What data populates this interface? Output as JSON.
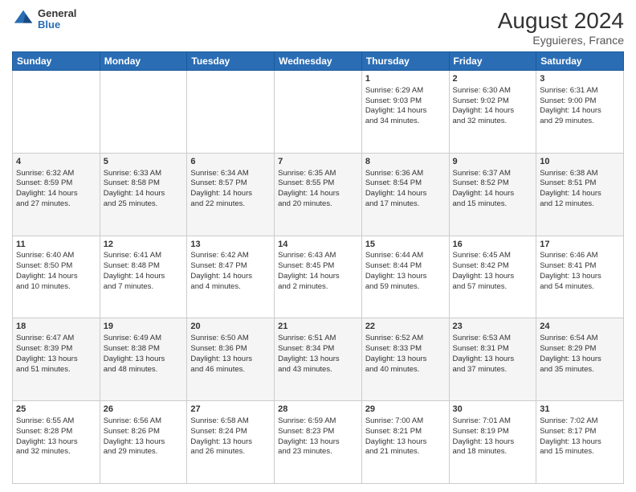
{
  "header": {
    "logo_general": "General",
    "logo_blue": "Blue",
    "month_year": "August 2024",
    "location": "Eyguieres, France"
  },
  "weekdays": [
    "Sunday",
    "Monday",
    "Tuesday",
    "Wednesday",
    "Thursday",
    "Friday",
    "Saturday"
  ],
  "weeks": [
    [
      {
        "day": "",
        "lines": []
      },
      {
        "day": "",
        "lines": []
      },
      {
        "day": "",
        "lines": []
      },
      {
        "day": "",
        "lines": []
      },
      {
        "day": "1",
        "lines": [
          "Sunrise: 6:29 AM",
          "Sunset: 9:03 PM",
          "Daylight: 14 hours",
          "and 34 minutes."
        ]
      },
      {
        "day": "2",
        "lines": [
          "Sunrise: 6:30 AM",
          "Sunset: 9:02 PM",
          "Daylight: 14 hours",
          "and 32 minutes."
        ]
      },
      {
        "day": "3",
        "lines": [
          "Sunrise: 6:31 AM",
          "Sunset: 9:00 PM",
          "Daylight: 14 hours",
          "and 29 minutes."
        ]
      }
    ],
    [
      {
        "day": "4",
        "lines": [
          "Sunrise: 6:32 AM",
          "Sunset: 8:59 PM",
          "Daylight: 14 hours",
          "and 27 minutes."
        ]
      },
      {
        "day": "5",
        "lines": [
          "Sunrise: 6:33 AM",
          "Sunset: 8:58 PM",
          "Daylight: 14 hours",
          "and 25 minutes."
        ]
      },
      {
        "day": "6",
        "lines": [
          "Sunrise: 6:34 AM",
          "Sunset: 8:57 PM",
          "Daylight: 14 hours",
          "and 22 minutes."
        ]
      },
      {
        "day": "7",
        "lines": [
          "Sunrise: 6:35 AM",
          "Sunset: 8:55 PM",
          "Daylight: 14 hours",
          "and 20 minutes."
        ]
      },
      {
        "day": "8",
        "lines": [
          "Sunrise: 6:36 AM",
          "Sunset: 8:54 PM",
          "Daylight: 14 hours",
          "and 17 minutes."
        ]
      },
      {
        "day": "9",
        "lines": [
          "Sunrise: 6:37 AM",
          "Sunset: 8:52 PM",
          "Daylight: 14 hours",
          "and 15 minutes."
        ]
      },
      {
        "day": "10",
        "lines": [
          "Sunrise: 6:38 AM",
          "Sunset: 8:51 PM",
          "Daylight: 14 hours",
          "and 12 minutes."
        ]
      }
    ],
    [
      {
        "day": "11",
        "lines": [
          "Sunrise: 6:40 AM",
          "Sunset: 8:50 PM",
          "Daylight: 14 hours",
          "and 10 minutes."
        ]
      },
      {
        "day": "12",
        "lines": [
          "Sunrise: 6:41 AM",
          "Sunset: 8:48 PM",
          "Daylight: 14 hours",
          "and 7 minutes."
        ]
      },
      {
        "day": "13",
        "lines": [
          "Sunrise: 6:42 AM",
          "Sunset: 8:47 PM",
          "Daylight: 14 hours",
          "and 4 minutes."
        ]
      },
      {
        "day": "14",
        "lines": [
          "Sunrise: 6:43 AM",
          "Sunset: 8:45 PM",
          "Daylight: 14 hours",
          "and 2 minutes."
        ]
      },
      {
        "day": "15",
        "lines": [
          "Sunrise: 6:44 AM",
          "Sunset: 8:44 PM",
          "Daylight: 13 hours",
          "and 59 minutes."
        ]
      },
      {
        "day": "16",
        "lines": [
          "Sunrise: 6:45 AM",
          "Sunset: 8:42 PM",
          "Daylight: 13 hours",
          "and 57 minutes."
        ]
      },
      {
        "day": "17",
        "lines": [
          "Sunrise: 6:46 AM",
          "Sunset: 8:41 PM",
          "Daylight: 13 hours",
          "and 54 minutes."
        ]
      }
    ],
    [
      {
        "day": "18",
        "lines": [
          "Sunrise: 6:47 AM",
          "Sunset: 8:39 PM",
          "Daylight: 13 hours",
          "and 51 minutes."
        ]
      },
      {
        "day": "19",
        "lines": [
          "Sunrise: 6:49 AM",
          "Sunset: 8:38 PM",
          "Daylight: 13 hours",
          "and 48 minutes."
        ]
      },
      {
        "day": "20",
        "lines": [
          "Sunrise: 6:50 AM",
          "Sunset: 8:36 PM",
          "Daylight: 13 hours",
          "and 46 minutes."
        ]
      },
      {
        "day": "21",
        "lines": [
          "Sunrise: 6:51 AM",
          "Sunset: 8:34 PM",
          "Daylight: 13 hours",
          "and 43 minutes."
        ]
      },
      {
        "day": "22",
        "lines": [
          "Sunrise: 6:52 AM",
          "Sunset: 8:33 PM",
          "Daylight: 13 hours",
          "and 40 minutes."
        ]
      },
      {
        "day": "23",
        "lines": [
          "Sunrise: 6:53 AM",
          "Sunset: 8:31 PM",
          "Daylight: 13 hours",
          "and 37 minutes."
        ]
      },
      {
        "day": "24",
        "lines": [
          "Sunrise: 6:54 AM",
          "Sunset: 8:29 PM",
          "Daylight: 13 hours",
          "and 35 minutes."
        ]
      }
    ],
    [
      {
        "day": "25",
        "lines": [
          "Sunrise: 6:55 AM",
          "Sunset: 8:28 PM",
          "Daylight: 13 hours",
          "and 32 minutes."
        ]
      },
      {
        "day": "26",
        "lines": [
          "Sunrise: 6:56 AM",
          "Sunset: 8:26 PM",
          "Daylight: 13 hours",
          "and 29 minutes."
        ]
      },
      {
        "day": "27",
        "lines": [
          "Sunrise: 6:58 AM",
          "Sunset: 8:24 PM",
          "Daylight: 13 hours",
          "and 26 minutes."
        ]
      },
      {
        "day": "28",
        "lines": [
          "Sunrise: 6:59 AM",
          "Sunset: 8:23 PM",
          "Daylight: 13 hours",
          "and 23 minutes."
        ]
      },
      {
        "day": "29",
        "lines": [
          "Sunrise: 7:00 AM",
          "Sunset: 8:21 PM",
          "Daylight: 13 hours",
          "and 21 minutes."
        ]
      },
      {
        "day": "30",
        "lines": [
          "Sunrise: 7:01 AM",
          "Sunset: 8:19 PM",
          "Daylight: 13 hours",
          "and 18 minutes."
        ]
      },
      {
        "day": "31",
        "lines": [
          "Sunrise: 7:02 AM",
          "Sunset: 8:17 PM",
          "Daylight: 13 hours",
          "and 15 minutes."
        ]
      }
    ]
  ]
}
